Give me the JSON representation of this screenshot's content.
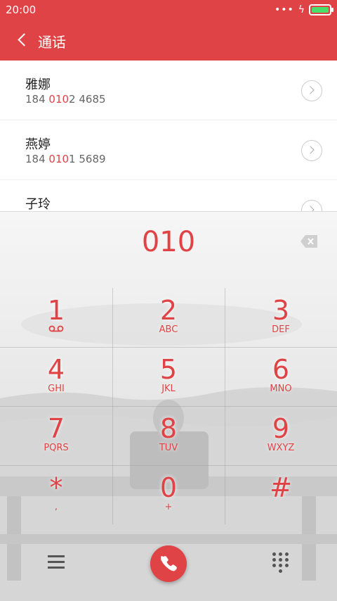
{
  "status": {
    "time": "20:00",
    "colors": {
      "bar": "#e04345",
      "battery": "#48e06a"
    }
  },
  "header": {
    "title": "通话",
    "back_icon": "chevron-left-icon"
  },
  "contacts": [
    {
      "name": "雅娜",
      "num_prefix": "184 ",
      "num_match": "010",
      "num_suffix": "2 4685"
    },
    {
      "name": "燕婷",
      "num_prefix": "184 ",
      "num_match": "010",
      "num_suffix": "1 5689"
    },
    {
      "name": "子玲",
      "num_prefix": "",
      "num_match": "",
      "num_suffix": ""
    }
  ],
  "dialer": {
    "input": "010",
    "accent": "#e04345",
    "keys": [
      {
        "digit": "1",
        "sub": "voicemail-icon"
      },
      {
        "digit": "2",
        "sub": "ABC"
      },
      {
        "digit": "3",
        "sub": "DEF"
      },
      {
        "digit": "4",
        "sub": "GHI"
      },
      {
        "digit": "5",
        "sub": "JKL"
      },
      {
        "digit": "6",
        "sub": "MNO"
      },
      {
        "digit": "7",
        "sub": "PQRS"
      },
      {
        "digit": "8",
        "sub": "TUV"
      },
      {
        "digit": "9",
        "sub": "WXYZ"
      },
      {
        "digit": "*",
        "sub": ","
      },
      {
        "digit": "0",
        "sub": "+"
      },
      {
        "digit": "#",
        "sub": ""
      }
    ]
  }
}
